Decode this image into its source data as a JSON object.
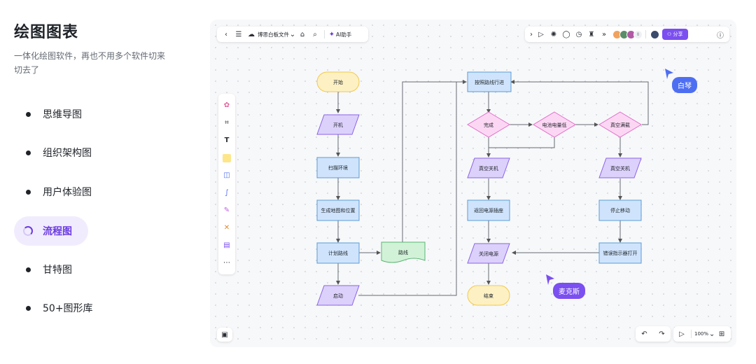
{
  "left": {
    "title": "绘图图表",
    "subtitle": "一体化绘图软件，再也不用多个软件切来切去了",
    "features": [
      "思维导图",
      "组织架构图",
      "用户体验图",
      "流程图",
      "甘特图",
      "50+图形库"
    ],
    "active_feature": "流程图"
  },
  "toolbar": {
    "filename": "博思白板文件",
    "ai_label": "AI助手",
    "share_label": "分享",
    "avatar_more": "8"
  },
  "zoom": {
    "level": "100%"
  },
  "cursors": {
    "user1": "白琴",
    "user2": "麦克斯"
  },
  "flowchart": {
    "start": "开始",
    "power_on": "开机",
    "scan": "扫描环境",
    "map": "生成地图和位置",
    "plan": "计划路线",
    "route": "路线",
    "launch": "启动",
    "follow": "按照路线行进",
    "done": "完成",
    "battery": "电池电量低",
    "vacuum_full": "真空满载",
    "vac_off_1": "真空关机",
    "vac_off_2": "真空关机",
    "return": "返回电源插座",
    "stop": "停止移动",
    "power_off": "关闭电源",
    "error": "错误指示器打开",
    "end": "结束"
  },
  "colors": {
    "accent": "#6b3be0",
    "terminal_fill": "#fdf1c4",
    "process_fill": "#cfe4fc",
    "io_fill": "#dcd1fb",
    "decision_fill": "#fcd7f4",
    "document_fill": "#d2f2d8"
  }
}
